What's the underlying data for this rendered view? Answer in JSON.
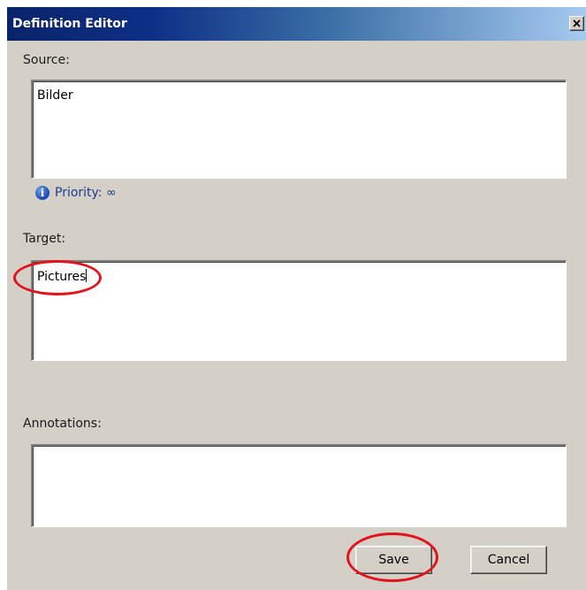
{
  "window": {
    "title": "Definition Editor",
    "close_glyph": "×"
  },
  "source": {
    "label": "Source:",
    "value": "Bilder"
  },
  "priority": {
    "icon": "info-icon",
    "text": "Priority: ∞"
  },
  "target": {
    "label": "Target:",
    "value": "Pictures"
  },
  "annotations": {
    "label": "Annotations:",
    "value": ""
  },
  "buttons": {
    "save": "Save",
    "cancel": "Cancel"
  },
  "colors": {
    "highlight": "#e0141c",
    "titlebar_start": "#0a246a",
    "titlebar_end": "#a6caf0",
    "dialog_bg": "#d4d0c8"
  }
}
